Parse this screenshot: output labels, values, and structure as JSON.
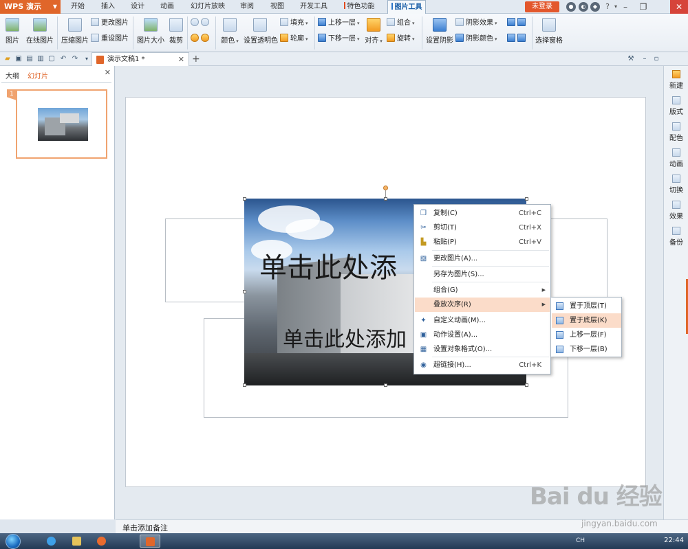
{
  "app": {
    "title": "WPS 演示"
  },
  "menu_tabs": [
    {
      "label": "开始"
    },
    {
      "label": "插入"
    },
    {
      "label": "设计"
    },
    {
      "label": "动画"
    },
    {
      "label": "幻灯片放映"
    },
    {
      "label": "审阅"
    },
    {
      "label": "视图"
    },
    {
      "label": "开发工具"
    },
    {
      "label": "特色功能"
    },
    {
      "label": "图片工具"
    }
  ],
  "account": {
    "login_label": "未登录",
    "help_label": "?"
  },
  "ribbon": {
    "picture": "图片",
    "online_picture": "在线图片",
    "compress": "压缩图片",
    "change_picture": "更改图片",
    "reset_picture": "重设图片",
    "picture_size": "图片大小",
    "crop": "裁剪",
    "color": "颜色",
    "set_transparent": "设置透明色",
    "fill": "填充",
    "outline": "轮廓",
    "bring_forward": "上移一层",
    "send_backward": "下移一层",
    "align": "对齐",
    "group": "组合",
    "rotate": "旋转",
    "set_shadow": "设置阴影",
    "shadow_effect": "阴影效果",
    "shadow_color": "阴影颜色",
    "selection_pane": "选择窗格"
  },
  "document": {
    "tab_name": "演示文稿1 *"
  },
  "left_panel": {
    "tab_outline": "大纲",
    "tab_slides": "幻灯片",
    "slide_number": "1"
  },
  "slide": {
    "title_placeholder": "单击此处添",
    "subtitle_placeholder": "单击此处添加",
    "notes_placeholder": "单击添加备注"
  },
  "context_menu": {
    "items": [
      {
        "label": "复制(C)",
        "shortcut": "Ctrl+C",
        "icon": "copy-icon"
      },
      {
        "label": "剪切(T)",
        "shortcut": "Ctrl+X",
        "icon": "cut-icon"
      },
      {
        "label": "粘贴(P)",
        "shortcut": "Ctrl+V",
        "icon": "paste-icon"
      },
      {
        "label": "更改图片(A)...",
        "shortcut": "",
        "icon": "change-picture-icon"
      },
      {
        "label": "另存为图片(S)...",
        "shortcut": "",
        "icon": ""
      },
      {
        "label": "组合(G)",
        "shortcut": "",
        "icon": ""
      },
      {
        "label": "叠放次序(R)",
        "shortcut": "",
        "icon": ""
      },
      {
        "label": "自定义动画(M)...",
        "shortcut": "",
        "icon": "custom-animation-icon"
      },
      {
        "label": "动作设置(A)...",
        "shortcut": "",
        "icon": "action-settings-icon"
      },
      {
        "label": "设置对象格式(O)...",
        "shortcut": "",
        "icon": "format-object-icon"
      },
      {
        "label": "超链接(H)...",
        "shortcut": "Ctrl+K",
        "icon": "hyperlink-icon"
      }
    ]
  },
  "submenu": {
    "items": [
      {
        "label": "置于顶层(T)"
      },
      {
        "label": "置于底层(K)"
      },
      {
        "label": "上移一层(F)"
      },
      {
        "label": "下移一层(B)"
      }
    ]
  },
  "right_pane": {
    "items": [
      {
        "label": "新建"
      },
      {
        "label": "版式"
      },
      {
        "label": "配色"
      },
      {
        "label": "动画"
      },
      {
        "label": "切换"
      },
      {
        "label": "效果"
      },
      {
        "label": "备份"
      }
    ]
  },
  "taskbar": {
    "clock": "22:44",
    "ime": "CH"
  },
  "watermark": {
    "brand": "Bai du 经验",
    "url": "jingyan.baidu.com"
  }
}
